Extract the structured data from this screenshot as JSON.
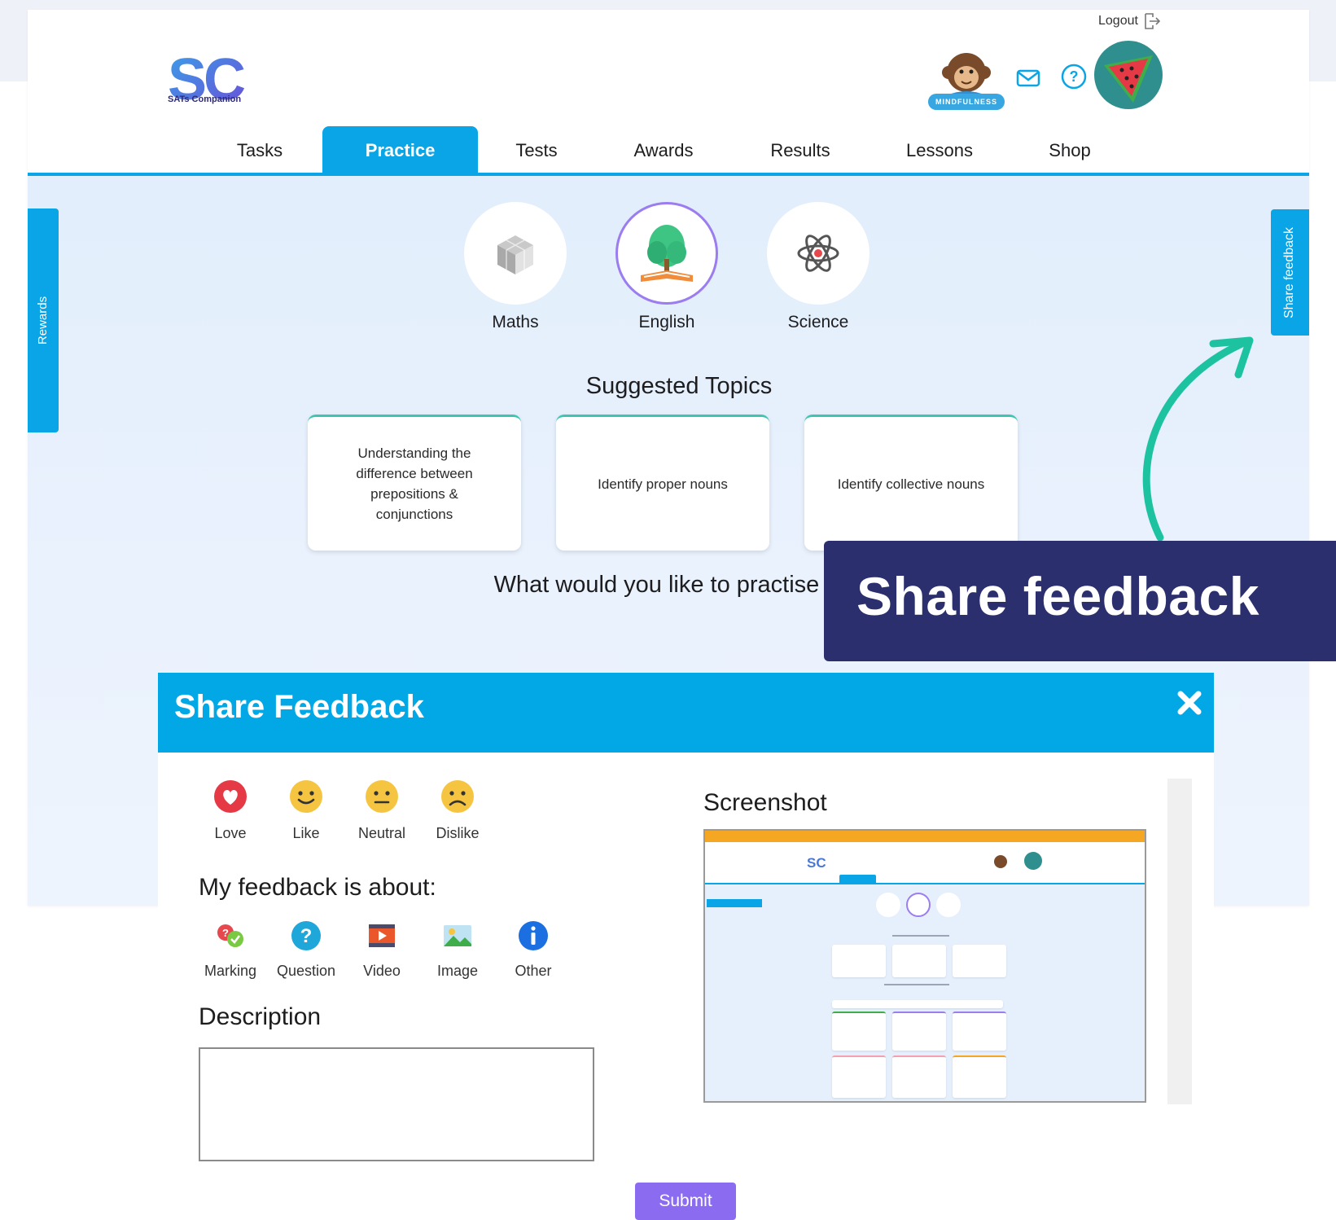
{
  "header": {
    "logo_text": "SC",
    "logo_caption": "SATs Companion",
    "logout_label": "Logout",
    "mindfulness_badge": "MINDFULNESS"
  },
  "nav": {
    "tabs": [
      {
        "label": "Tasks",
        "active": false
      },
      {
        "label": "Practice",
        "active": true
      },
      {
        "label": "Tests",
        "active": false
      },
      {
        "label": "Awards",
        "active": false
      },
      {
        "label": "Results",
        "active": false
      },
      {
        "label": "Lessons",
        "active": false
      },
      {
        "label": "Shop",
        "active": false
      }
    ]
  },
  "side": {
    "rewards_label": "Rewards",
    "share_feedback_label": "Share feedback"
  },
  "subjects": [
    {
      "label": "Maths",
      "icon": "cube-icon",
      "selected": false
    },
    {
      "label": "English",
      "icon": "tree-book-icon",
      "selected": true
    },
    {
      "label": "Science",
      "icon": "atom-icon",
      "selected": false
    }
  ],
  "suggested": {
    "title": "Suggested Topics",
    "topics": [
      "Understanding the difference between prepositions & conjunctions",
      "Identify proper nouns",
      "Identify collective nouns"
    ]
  },
  "practise_question": "What would you like to practise today?",
  "callout": {
    "text": "Share feedback"
  },
  "modal": {
    "title": "Share Feedback",
    "reactions": [
      {
        "label": "Love",
        "icon": "heart-icon"
      },
      {
        "label": "Like",
        "icon": "smile-icon"
      },
      {
        "label": "Neutral",
        "icon": "neutral-face-icon"
      },
      {
        "label": "Dislike",
        "icon": "sad-face-icon"
      }
    ],
    "about_title": "My feedback is about:",
    "about_options": [
      {
        "label": "Marking",
        "icon": "marking-icon"
      },
      {
        "label": "Question",
        "icon": "question-icon"
      },
      {
        "label": "Video",
        "icon": "video-icon"
      },
      {
        "label": "Image",
        "icon": "image-icon"
      },
      {
        "label": "Other",
        "icon": "info-icon"
      }
    ],
    "description_title": "Description",
    "description_value": "",
    "screenshot_title": "Screenshot",
    "submit_label": "Submit"
  },
  "colors": {
    "accent_blue": "#0aa5e6",
    "callout_navy": "#2b2f6e",
    "submit_purple": "#8b6cf0",
    "arrow_teal": "#1dc3a0"
  }
}
